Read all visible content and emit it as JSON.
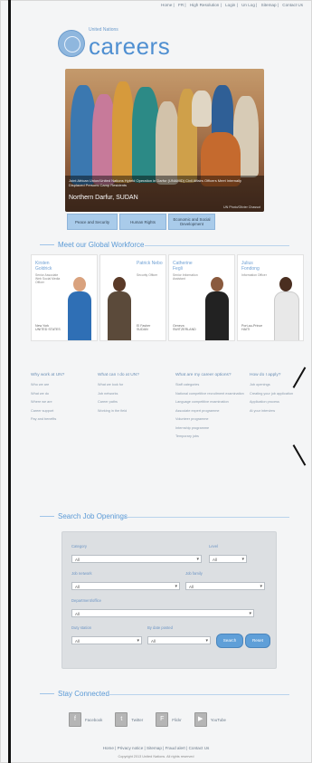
{
  "top_nav": {
    "items": [
      "Home",
      "FR",
      "High Resolution",
      "Login",
      "Un Log",
      "Sitemap",
      "Contact Us"
    ]
  },
  "logo": {
    "small": "United Nations",
    "big": "careers"
  },
  "hero": {
    "caption": "Joint African Union/United Nations Hybrid Operation in Darfur (UNAMID) Civil Affairs Officers Meet Internally Displaced Persons Camp Residents",
    "location": "Northern Darfur, SUDAN",
    "credit": "UN Photo/Olivier Chassot",
    "tabs": [
      "Peace and Security",
      "Human Rights",
      "Economic and Social Development"
    ]
  },
  "workforce": {
    "title": "Meet our Global Workforce",
    "people": [
      {
        "name": "Kirsten Goldrick",
        "role": "Senior Associate Web Social Media Officer",
        "city": "New York",
        "country": "UNITED STATES"
      },
      {
        "name": "Patrick Nebo",
        "role": "Security Officer",
        "city": "El Fasher",
        "country": "SUDAN"
      },
      {
        "name": "Catherine Fegli",
        "role": "Senior Information Assistant",
        "city": "Geneva",
        "country": "SWITZERLAND"
      },
      {
        "name": "Julius Fondong",
        "role": "Information Officer",
        "city": "Port-au-Prince",
        "country": "HAITI"
      }
    ]
  },
  "info_columns": [
    {
      "heading": "Why work at UN?",
      "links": [
        "Who we are",
        "What we do",
        "Where we are",
        "Career support",
        "Pay and benefits"
      ]
    },
    {
      "heading": "What can I do at UN?",
      "links": [
        "What we look for",
        "Job networks",
        "Career paths",
        "Working in the field"
      ]
    },
    {
      "heading": "What are my career options?",
      "links": [
        "Staff categories",
        "National competitive recruitment examination",
        "Language competitive examination",
        "Associate expert programme",
        "Volunteer programme",
        "Internship programme",
        "Temporary jobs"
      ]
    },
    {
      "heading": "How do I apply?",
      "links": [
        "Job openings",
        "Creating your job application",
        "Application process",
        "At your interview"
      ]
    }
  ],
  "search": {
    "title": "Search Job Openings",
    "fields": {
      "category": {
        "label": "Category",
        "value": "All"
      },
      "level": {
        "label": "Level",
        "value": "All"
      },
      "job_network": {
        "label": "Job network",
        "value": "All"
      },
      "job_family": {
        "label": "Job family",
        "value": "All"
      },
      "department": {
        "label": "Department/office",
        "value": "All"
      },
      "duty_station": {
        "label": "Duty station",
        "value": "All"
      },
      "date_posted": {
        "label": "By date posted",
        "value": "All"
      }
    },
    "search_button": "Search",
    "reset_button": "Reset"
  },
  "stay_connected": {
    "title": "Stay Connected",
    "items": [
      {
        "label": "Facebook",
        "glyph": "f"
      },
      {
        "label": "Twitter",
        "glyph": "t"
      },
      {
        "label": "Flickr",
        "glyph": "F"
      },
      {
        "label": "YouTube",
        "glyph": "▶"
      }
    ]
  },
  "footer": {
    "links": "Home | Privacy notice | Sitemap | Fraud alert | Contact Us",
    "copyright": "Copyright 2013 United Nations. All rights reserved"
  },
  "colors": {
    "brand_blue": "#4f8fd1",
    "tab_blue": "#a9cbea",
    "button_blue": "#5f9fd8"
  }
}
